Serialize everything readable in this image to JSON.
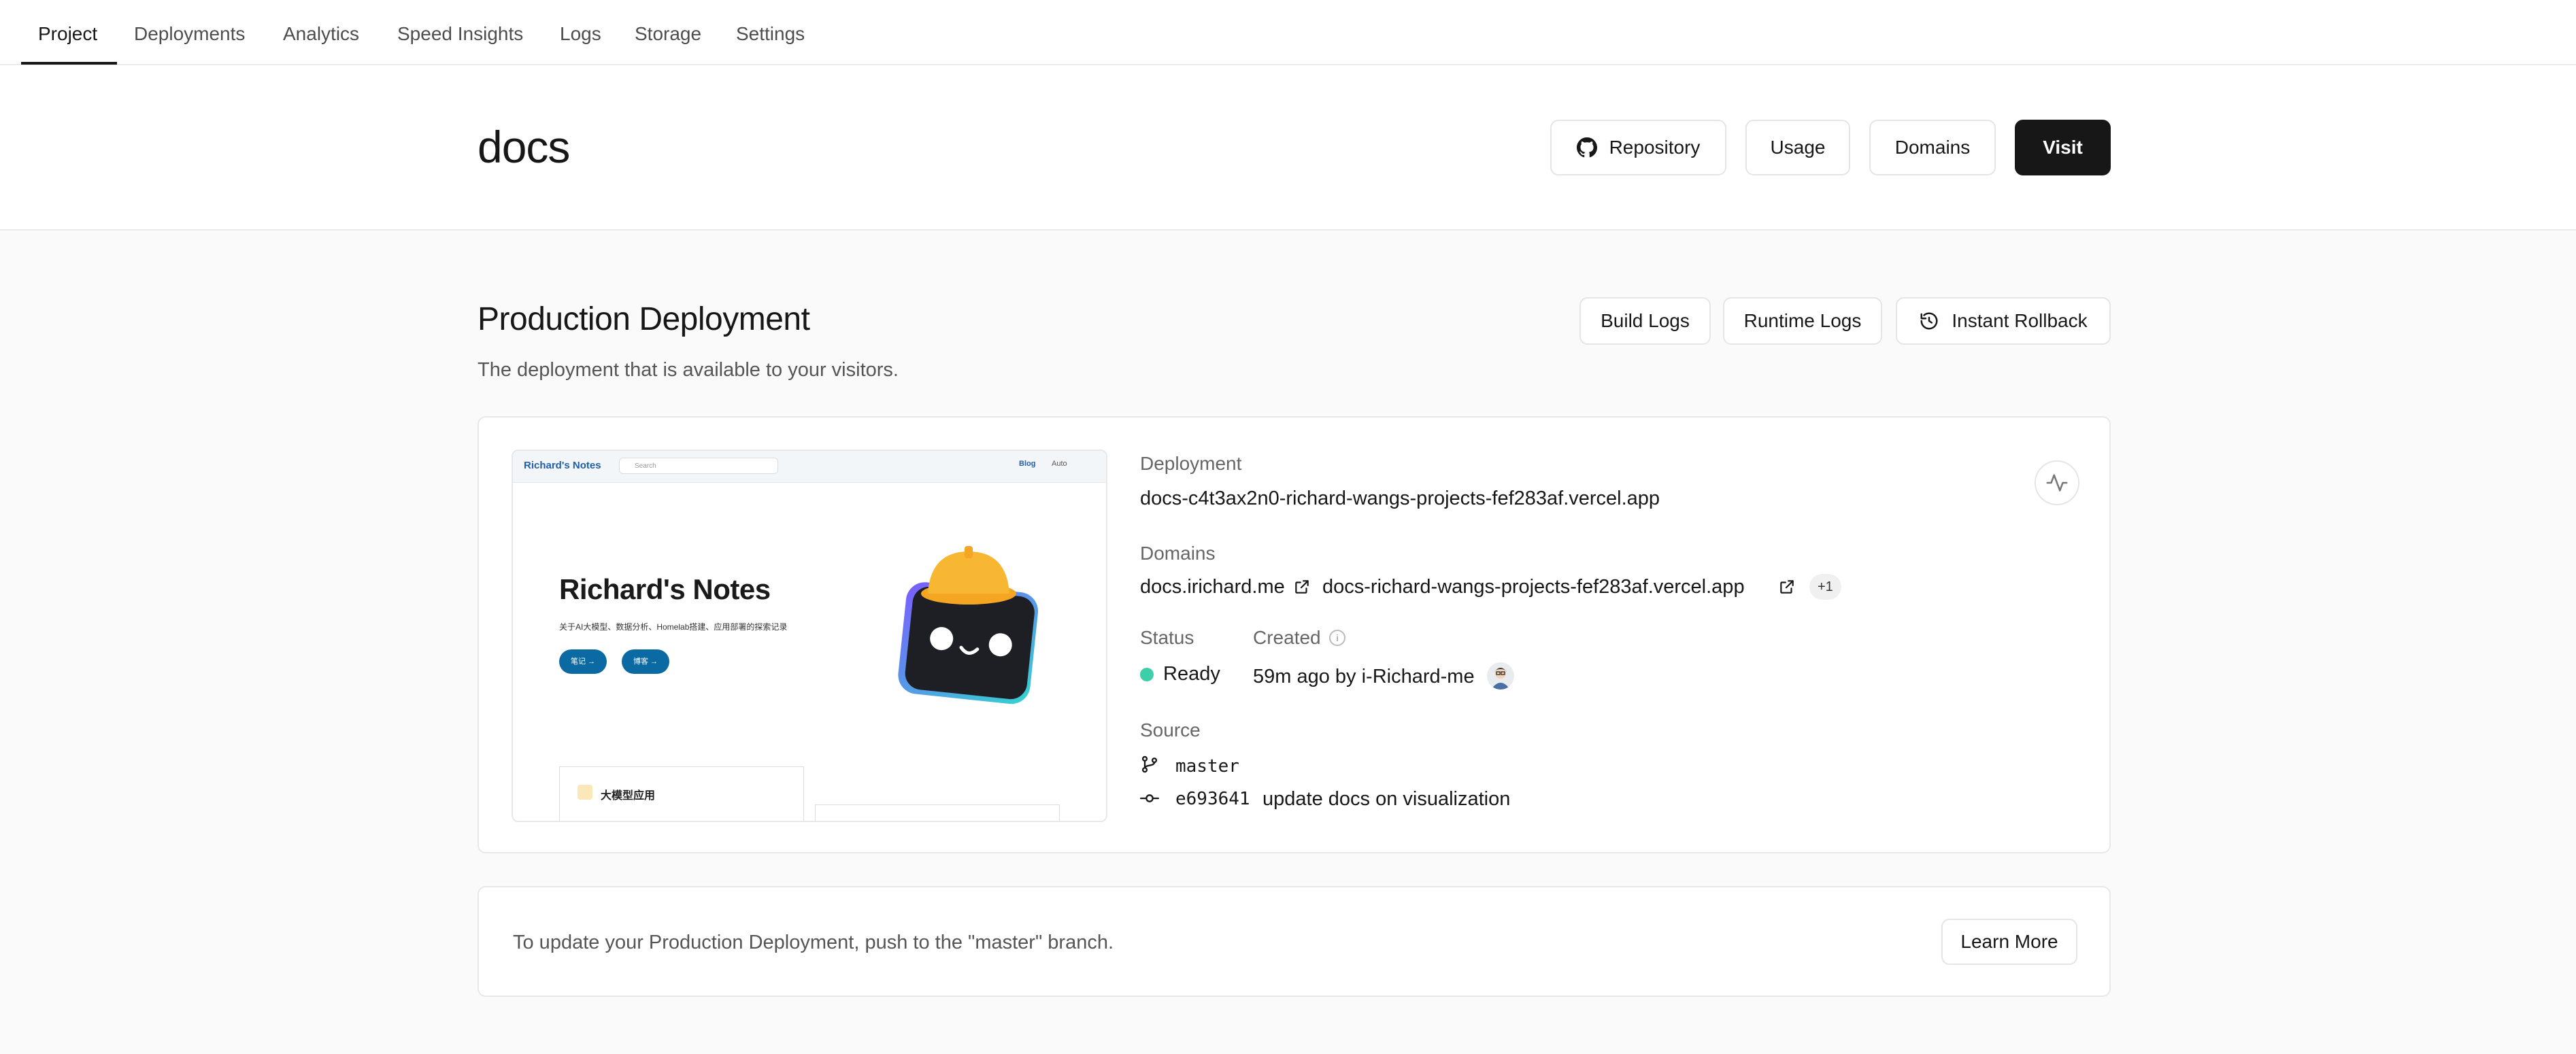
{
  "nav": {
    "tabs": [
      "Project",
      "Deployments",
      "Analytics",
      "Speed Insights",
      "Logs",
      "Storage",
      "Settings"
    ],
    "active_tab": "Project"
  },
  "header": {
    "project_name": "docs",
    "repository_label": "Repository",
    "usage_label": "Usage",
    "domains_label": "Domains",
    "visit_label": "Visit"
  },
  "production": {
    "title": "Production Deployment",
    "subtitle": "The deployment that is available to your visitors.",
    "build_logs_label": "Build Logs",
    "runtime_logs_label": "Runtime Logs",
    "rollback_label": "Instant Rollback"
  },
  "preview": {
    "site_name": "Richard's Notes",
    "search_placeholder": "Search",
    "blog_label": "Blog",
    "auto_label": "Auto",
    "heading": "Richard's Notes",
    "description": "关于AI大模型、数据分析、Homelab搭建、应用部署的探索记录",
    "btn_notes": "笔记",
    "btn_blog": "博客",
    "section_label": "大模型应用"
  },
  "deployment": {
    "deployment_label": "Deployment",
    "deployment_url": "docs-c4t3ax2n0-richard-wangs-projects-fef283af.vercel.app",
    "domains_label": "Domains",
    "domain_primary": "docs.irichard.me",
    "domain_secondary": "docs-richard-wangs-projects-fef283af.vercel.app",
    "domains_more": "+1",
    "status_label": "Status",
    "status_value": "Ready",
    "created_label": "Created",
    "created_value": "59m ago by i-Richard-me",
    "source_label": "Source",
    "branch": "master",
    "commit_hash": "e693641",
    "commit_message": "update docs on visualization"
  },
  "footer_card": {
    "message": "To update your Production Deployment, push to the \"master\" branch.",
    "learn_more_label": "Learn More"
  },
  "colors": {
    "accent_dark": "#171717",
    "status_ready": "#3ccfa8",
    "preview_link": "#1f5fa8",
    "preview_button": "#0b6aa2"
  }
}
